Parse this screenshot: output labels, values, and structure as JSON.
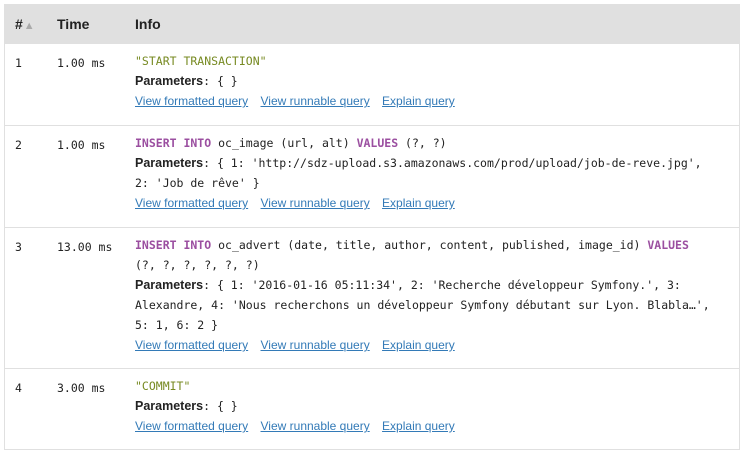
{
  "table": {
    "headers": {
      "num": "#",
      "time": "Time",
      "info": "Info"
    },
    "links": {
      "formatted": "View formatted query",
      "runnable": "View runnable query",
      "explain": "Explain query"
    },
    "params_label": "Parameters",
    "rows": [
      {
        "num": "1",
        "time": "1.00 ms",
        "sql": "\"START TRANSACTION\"",
        "params": ": { }"
      },
      {
        "num": "2",
        "time": "1.00 ms",
        "sql_kw1": "INSERT INTO",
        "sql_mid": " oc_image (url, alt) ",
        "sql_kw2": "VALUES",
        "sql_end": " (?, ?)",
        "params_line1": ": { 1: 'http://sdz-upload.s3.amazonaws.com/prod/upload/job-de-reve.jpg',",
        "params_line2": "2: 'Job de rêve' }"
      },
      {
        "num": "3",
        "time": "13.00 ms",
        "sql_kw1": "INSERT INTO",
        "sql_mid": " oc_advert (date, title, author, content, published, image_id) ",
        "sql_kw2": "VALUES",
        "sql_line2": "(?, ?, ?, ?, ?, ?)",
        "params_line1": ": { 1: '2016-01-16 05:11:34', 2: 'Recherche développeur Symfony.', 3:",
        "params_line2": "Alexandre, 4: 'Nous recherchons un développeur Symfony débutant sur Lyon. Blabla…',",
        "params_line3": "5: 1, 6: 2 }"
      },
      {
        "num": "4",
        "time": "3.00 ms",
        "sql": "\"COMMIT\"",
        "params": ": { }"
      }
    ]
  }
}
